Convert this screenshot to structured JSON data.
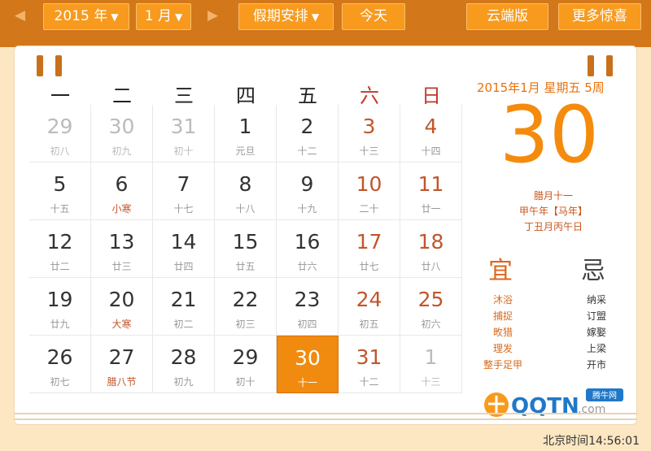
{
  "toolbar": {
    "prev_label": "◀",
    "year_label": "2015 年",
    "month_label": "1 月",
    "next_label": "▶",
    "holiday_label": "假期安排",
    "today_label": "今天",
    "cloud_label": "云端版",
    "more_label": "更多惊喜"
  },
  "weekdays": [
    "一",
    "二",
    "三",
    "四",
    "五",
    "六",
    "日"
  ],
  "days": [
    {
      "d": "29",
      "l": "初八",
      "type": "other"
    },
    {
      "d": "30",
      "l": "初九",
      "type": "other"
    },
    {
      "d": "31",
      "l": "初十",
      "type": "other"
    },
    {
      "d": "1",
      "l": "元旦",
      "type": ""
    },
    {
      "d": "2",
      "l": "十二",
      "type": ""
    },
    {
      "d": "3",
      "l": "十三",
      "type": "we"
    },
    {
      "d": "4",
      "l": "十四",
      "type": "we"
    },
    {
      "d": "5",
      "l": "十五",
      "type": ""
    },
    {
      "d": "6",
      "l": "小寒",
      "type": "",
      "fest": true
    },
    {
      "d": "7",
      "l": "十七",
      "type": ""
    },
    {
      "d": "8",
      "l": "十八",
      "type": ""
    },
    {
      "d": "9",
      "l": "十九",
      "type": ""
    },
    {
      "d": "10",
      "l": "二十",
      "type": "we"
    },
    {
      "d": "11",
      "l": "廿一",
      "type": "we"
    },
    {
      "d": "12",
      "l": "廿二",
      "type": ""
    },
    {
      "d": "13",
      "l": "廿三",
      "type": ""
    },
    {
      "d": "14",
      "l": "廿四",
      "type": ""
    },
    {
      "d": "15",
      "l": "廿五",
      "type": ""
    },
    {
      "d": "16",
      "l": "廿六",
      "type": ""
    },
    {
      "d": "17",
      "l": "廿七",
      "type": "we"
    },
    {
      "d": "18",
      "l": "廿八",
      "type": "we"
    },
    {
      "d": "19",
      "l": "廿九",
      "type": ""
    },
    {
      "d": "20",
      "l": "大寒",
      "type": "",
      "fest": true
    },
    {
      "d": "21",
      "l": "初二",
      "type": ""
    },
    {
      "d": "22",
      "l": "初三",
      "type": ""
    },
    {
      "d": "23",
      "l": "初四",
      "type": ""
    },
    {
      "d": "24",
      "l": "初五",
      "type": "we"
    },
    {
      "d": "25",
      "l": "初六",
      "type": "we"
    },
    {
      "d": "26",
      "l": "初七",
      "type": ""
    },
    {
      "d": "27",
      "l": "腊八节",
      "type": "",
      "fest": true
    },
    {
      "d": "28",
      "l": "初九",
      "type": ""
    },
    {
      "d": "29",
      "l": "初十",
      "type": ""
    },
    {
      "d": "30",
      "l": "十一",
      "type": "today"
    },
    {
      "d": "31",
      "l": "十二",
      "type": "we"
    },
    {
      "d": "1",
      "l": "十三",
      "type": "other"
    }
  ],
  "detail": {
    "header": "2015年1月 星期五 5周",
    "big_day": "30",
    "lunar_day": "腊月十一",
    "ganzhi_year": "甲午年【马年】",
    "ganzhi_month_day": "丁丑月丙午日",
    "yi_label": "宜",
    "ji_label": "忌",
    "yi_items": [
      "沐浴",
      "捕捉",
      "畋猎",
      "理发",
      "整手足甲"
    ],
    "ji_items": [
      "纳采",
      "订盟",
      "嫁娶",
      "上梁",
      "开市"
    ]
  },
  "logo": {
    "text": "QQTN",
    "suffix": ".com",
    "badge": "腾牛网"
  },
  "clock": "北京时间14:56:01",
  "colors": {
    "accent": "#f79a1e",
    "top_bar": "#d2781a",
    "today_bg": "#f08b10",
    "weekend": "#c0562b"
  }
}
